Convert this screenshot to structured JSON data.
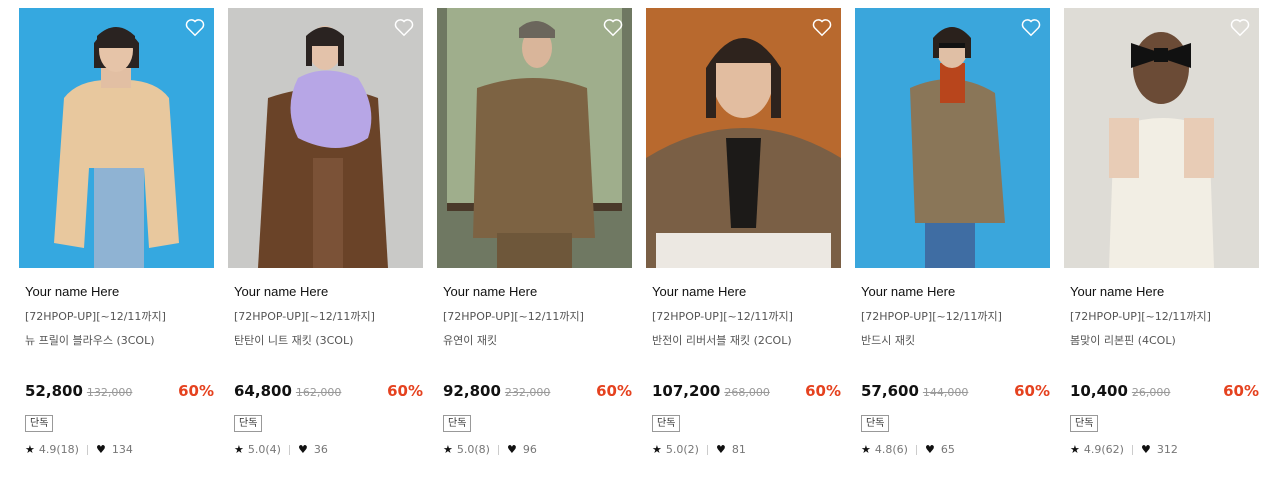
{
  "products": [
    {
      "brand": "Your name Here",
      "promo": "[72HPOP-UP][~12/11까지]",
      "name": "뉴 프릴이 블라우스 (3COL)",
      "price": "52,800",
      "original_price": "132,000",
      "discount": "60%",
      "tag": "단독",
      "rating": "4.9(18)",
      "likes": "134",
      "bg": "#35a8e0"
    },
    {
      "brand": "Your name Here",
      "promo": "[72HPOP-UP][~12/11까지]",
      "name": "탄탄이 니트 재킷 (3COL)",
      "price": "64,800",
      "original_price": "162,000",
      "discount": "60%",
      "tag": "단독",
      "rating": "5.0(4)",
      "likes": "36",
      "bg": "#c9c9c7"
    },
    {
      "brand": "Your name Here",
      "promo": "[72HPOP-UP][~12/11까지]",
      "name": "유연이 재킷",
      "price": "92,800",
      "original_price": "232,000",
      "discount": "60%",
      "tag": "단독",
      "rating": "5.0(8)",
      "likes": "96",
      "bg": "#6f7862"
    },
    {
      "brand": "Your name Here",
      "promo": "[72HPOP-UP][~12/11까지]",
      "name": "반전이 리버서블 재킷 (2COL)",
      "price": "107,200",
      "original_price": "268,000",
      "discount": "60%",
      "tag": "단독",
      "rating": "5.0(2)",
      "likes": "81",
      "bg": "#b8692e"
    },
    {
      "brand": "Your name Here",
      "promo": "[72HPOP-UP][~12/11까지]",
      "name": "반드시 재킷",
      "price": "57,600",
      "original_price": "144,000",
      "discount": "60%",
      "tag": "단독",
      "rating": "4.8(6)",
      "likes": "65",
      "bg": "#3aa6dc"
    },
    {
      "brand": "Your name Here",
      "promo": "[72HPOP-UP][~12/11까지]",
      "name": "봄맞이 리본핀 (4COL)",
      "price": "10,400",
      "original_price": "26,000",
      "discount": "60%",
      "tag": "단독",
      "rating": "4.9(62)",
      "likes": "312",
      "bg": "#dedcd6"
    }
  ],
  "icons": {
    "wishlist": "heart-outline-icon",
    "star": "star-icon",
    "like": "heart-filled-icon"
  }
}
